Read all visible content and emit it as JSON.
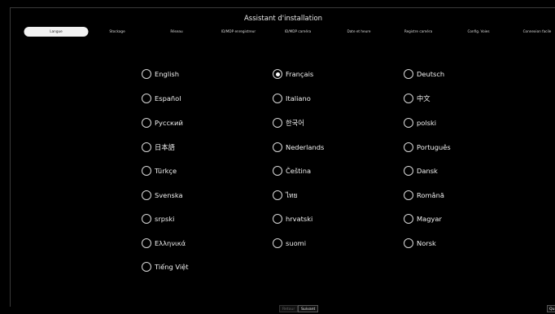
{
  "title": "Assistant d'installation",
  "steps": [
    {
      "label": "Langue",
      "active": true
    },
    {
      "label": "Stockage",
      "active": false
    },
    {
      "label": "Réseau",
      "active": false
    },
    {
      "label": "ID/MDP enregistreur",
      "active": false
    },
    {
      "label": "ID/MDP caméra",
      "active": false
    },
    {
      "label": "Date et heure",
      "active": false
    },
    {
      "label": "Registre caméra",
      "active": false
    },
    {
      "label": "Config. Voies",
      "active": false
    },
    {
      "label": "Connexion facile",
      "active": false
    }
  ],
  "languages": [
    {
      "label": "English",
      "selected": false
    },
    {
      "label": "Français",
      "selected": true
    },
    {
      "label": "Deutsch",
      "selected": false
    },
    {
      "label": "Español",
      "selected": false
    },
    {
      "label": "Italiano",
      "selected": false
    },
    {
      "label": "中文",
      "selected": false
    },
    {
      "label": "Русский",
      "selected": false
    },
    {
      "label": "한국어",
      "selected": false
    },
    {
      "label": "polski",
      "selected": false
    },
    {
      "label": "日本語",
      "selected": false
    },
    {
      "label": "Nederlands",
      "selected": false
    },
    {
      "label": "Português",
      "selected": false
    },
    {
      "label": "Türkçe",
      "selected": false
    },
    {
      "label": "Čeština",
      "selected": false
    },
    {
      "label": "Dansk",
      "selected": false
    },
    {
      "label": "Svenska",
      "selected": false
    },
    {
      "label": "ไทย",
      "selected": false
    },
    {
      "label": "Română",
      "selected": false
    },
    {
      "label": "srpski",
      "selected": false
    },
    {
      "label": "hrvatski",
      "selected": false
    },
    {
      "label": "Magyar",
      "selected": false
    },
    {
      "label": "Ελληνικά",
      "selected": false
    },
    {
      "label": "suomi",
      "selected": false
    },
    {
      "label": "Norsk",
      "selected": false
    },
    {
      "label": "Tiếng Việt",
      "selected": false
    }
  ],
  "footer": {
    "back_label": "Retour",
    "next_label": "Suivant",
    "quit_label": "Qu"
  }
}
